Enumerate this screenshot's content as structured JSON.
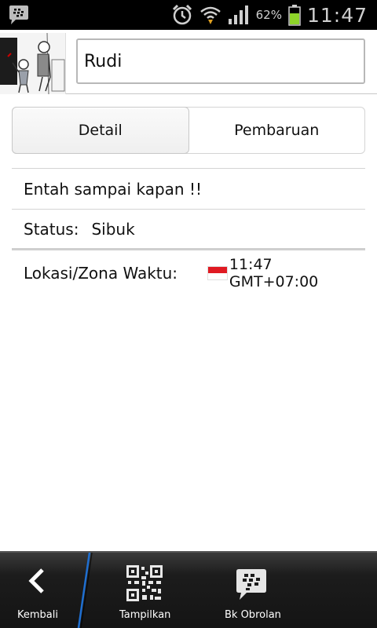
{
  "status_bar": {
    "battery_percent": "62%",
    "time": "11:47",
    "icons": [
      "bbm-notification-icon",
      "alarm-icon",
      "wifi-icon",
      "signal-icon",
      "battery-icon"
    ]
  },
  "profile": {
    "name": "Rudi",
    "avatar_icon": "cartoon-avatar"
  },
  "tabs": [
    {
      "label": "Detail",
      "active": true
    },
    {
      "label": "Pembaruan",
      "active": false
    }
  ],
  "details": {
    "personal_message": "Entah sampai kapan !!",
    "status_label": "Status:",
    "status_value": "Sibuk",
    "location_label": "Lokasi/Zona Waktu:",
    "location_value": "11:47 GMT+07:00",
    "flag_icon": "indonesia-flag-icon"
  },
  "bottom_bar": {
    "back_label": "Kembali",
    "show_label": "Tampilkan",
    "chat_label": "Bk Obrolan"
  },
  "colors": {
    "flag_red": "#e01a22",
    "accent_divider": "#1f6fd1",
    "battery_green": "#8ed42a"
  }
}
